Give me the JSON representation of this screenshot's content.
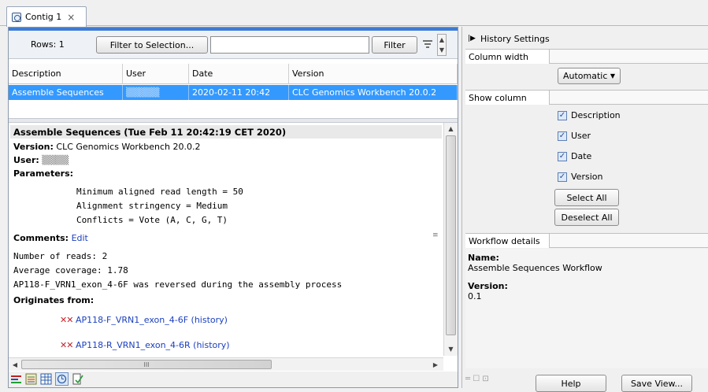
{
  "tab": {
    "title": "Contig 1",
    "close": "×"
  },
  "filterbar": {
    "rows_label": "Rows: 1",
    "filter_to_selection": "Filter to Selection...",
    "filter_input_value": "",
    "filter_button": "Filter"
  },
  "table": {
    "columns": [
      "Description",
      "User",
      "Date",
      "Version"
    ],
    "rows": [
      {
        "description": "Assemble Sequences",
        "user": "▒▒▒▒▒",
        "date": "2020-02-11 20:42",
        "version": "CLC Genomics Workbench 20.0.2"
      }
    ]
  },
  "details": {
    "heading": "Assemble Sequences (Tue Feb 11 20:42:19 CET 2020)",
    "version_label": "Version:",
    "version_value": " CLC Genomics Workbench 20.0.2",
    "user_label": "User:",
    "user_value": " ▒▒▒▒",
    "parameters_label": "Parameters:",
    "param1": "Minimum aligned read length = 50",
    "param2": "Alignment stringency = Medium",
    "param3": "Conflicts = Vote (A, C, G, T)",
    "comments_label": "Comments:",
    "comments_edit": "Edit",
    "comment1": "Number of reads: 2",
    "comment2": "Average coverage: 1.78",
    "comment3": "AP118-F_VRN1_exon_4-6F was reversed during the assembly process",
    "originates_label": "Originates from:",
    "origin1_name": "AP118-F_VRN1_exon_4-6F",
    "origin1_history": "(history)",
    "origin2_name": "AP118-R_VRN1_exon_4-6R",
    "origin2_history": "(history)",
    "h_thumb_mark": "III"
  },
  "right": {
    "title": "History Settings",
    "column_width_label": "Column width",
    "column_width_value": "Automatic",
    "show_column_label": "Show column",
    "checks": [
      "Description",
      "User",
      "Date",
      "Version"
    ],
    "select_all": "Select All",
    "deselect_all": "Deselect All",
    "workflow_label": "Workflow details",
    "name_label": "Name:",
    "name_value": "Assemble Sequences Workflow",
    "version_label": "Version:",
    "version_value": "0.1",
    "help_button": "Help",
    "save_view_button": "Save View..."
  },
  "colors": {
    "selection": "#3399ff",
    "accent": "#3f7bd4",
    "link": "#1a3fbf",
    "origin_icon": "#c0262d"
  }
}
